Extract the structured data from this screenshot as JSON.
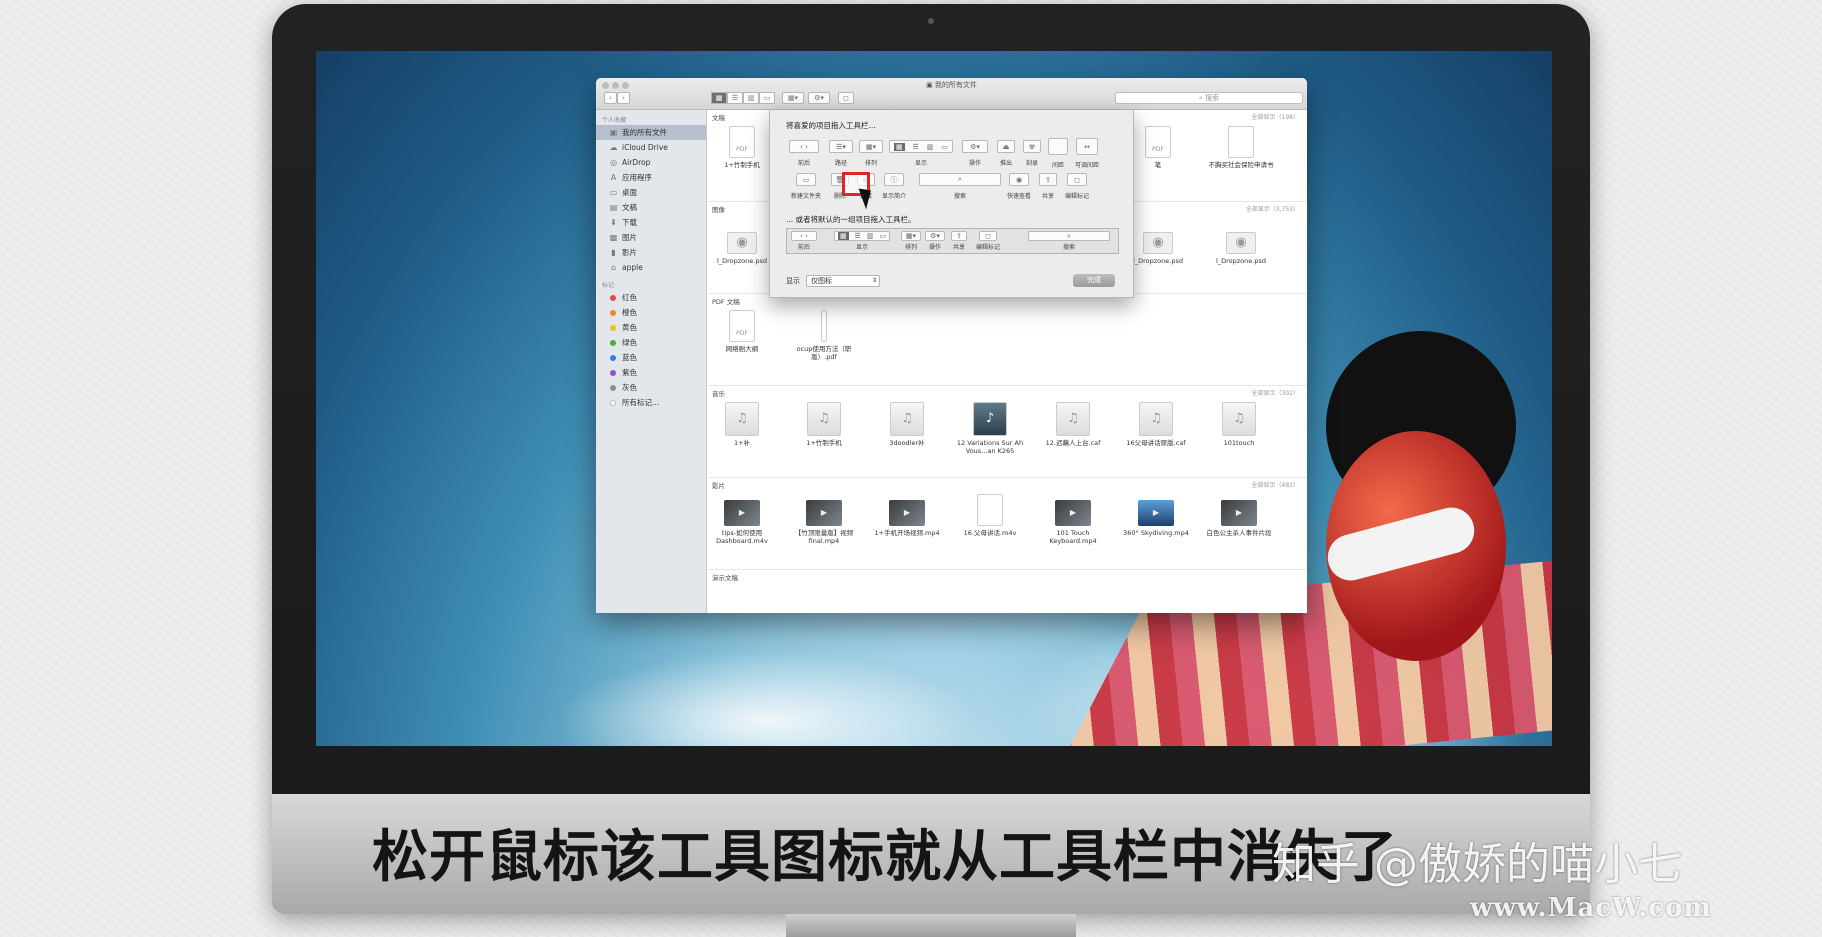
{
  "finder": {
    "title": "我的所有文件",
    "search_placeholder": "搜索",
    "nav_back": "‹",
    "nav_forward": "›"
  },
  "sidebar": {
    "favorites_heading": "个人收藏",
    "favorites": [
      {
        "label": "我的所有文件",
        "icon": "all-files-icon",
        "selected": true
      },
      {
        "label": "iCloud Drive",
        "icon": "cloud-icon"
      },
      {
        "label": "AirDrop",
        "icon": "airdrop-icon"
      },
      {
        "label": "应用程序",
        "icon": "applications-icon"
      },
      {
        "label": "桌面",
        "icon": "desktop-icon"
      },
      {
        "label": "文稿",
        "icon": "documents-icon"
      },
      {
        "label": "下载",
        "icon": "downloads-icon"
      },
      {
        "label": "图片",
        "icon": "pictures-icon"
      },
      {
        "label": "影片",
        "icon": "movies-icon"
      },
      {
        "label": "apple",
        "icon": "home-icon"
      }
    ],
    "tags_heading": "标记",
    "tags": [
      {
        "label": "红色",
        "color": "#e5484d"
      },
      {
        "label": "橙色",
        "color": "#f08a24"
      },
      {
        "label": "黄色",
        "color": "#e8c31f"
      },
      {
        "label": "绿色",
        "color": "#43b13a"
      },
      {
        "label": "蓝色",
        "color": "#2f7ee8"
      },
      {
        "label": "紫色",
        "color": "#9a4fd0"
      },
      {
        "label": "灰色",
        "color": "#8e8e8e"
      },
      {
        "label": "所有标记...",
        "color": "#c8c8c8"
      }
    ]
  },
  "sections": {
    "documents": {
      "title": "文稿",
      "count": "全部显示（198）",
      "items": [
        "1+竹制手机",
        "笔",
        "不胸买社会保险申请书"
      ]
    },
    "images": {
      "title": "图像",
      "count": "全部显示（3,753）",
      "items": [
        "l_Dropzone.psd",
        "l_Dropzone.psd",
        "l_Dropzone.psd"
      ]
    },
    "pdf": {
      "title": "PDF 文稿",
      "items": [
        "网络剧大纲",
        "ocup使用方法（职版）.pdf"
      ]
    },
    "music": {
      "title": "音乐",
      "count": "全部显示（302）",
      "items": [
        "1+补",
        "1+竹制手机",
        "3doodler补",
        "12 Variations Sur Ah Vous...an K265",
        "12.迟藕人上台.caf",
        "16父母讲话原版.caf",
        "101touch"
      ]
    },
    "movies": {
      "title": "影片",
      "count": "全部显示（483）",
      "items": [
        "tips-如何使用Dashboard.m4v",
        "【竹顶限量版】视频final.mp4",
        "1+手机开场视频.mp4",
        "16.父母讲话.m4v",
        "101 Touch Keyboard.mp4",
        "360° Skydiving.mp4",
        "白色公主杀人事件片段"
      ]
    },
    "presentations": {
      "title": "演示文稿"
    }
  },
  "customize": {
    "title": "将喜爱的项目拖入工具栏...",
    "row1": [
      {
        "label": "前后",
        "icon": "back-forward-icon"
      },
      {
        "label": "路径",
        "icon": "path-icon"
      },
      {
        "label": "排列",
        "icon": "arrange-icon"
      },
      {
        "label": "显示",
        "icon": "view-icon"
      },
      {
        "label": "操作",
        "icon": "gear-icon"
      },
      {
        "label": "推出",
        "icon": "eject-icon"
      },
      {
        "label": "刻录",
        "icon": "burn-icon"
      },
      {
        "label": "间距",
        "icon": "space-icon"
      },
      {
        "label": "可调间距",
        "icon": "flexible-space-icon"
      }
    ],
    "row2": [
      {
        "label": "新建文件夹",
        "icon": "new-folder-icon"
      },
      {
        "label": "删除",
        "icon": "trash-icon"
      },
      {
        "label": "连接",
        "icon": "connect-icon"
      },
      {
        "label": "显示简介",
        "icon": "info-icon"
      },
      {
        "label": "搜索",
        "icon": "search-icon"
      },
      {
        "label": "快速查看",
        "icon": "eye-icon"
      },
      {
        "label": "共享",
        "icon": "share-icon"
      },
      {
        "label": "编辑标记",
        "icon": "tag-icon"
      }
    ],
    "default_title": "... 或者将默认的一组项目拖入工具栏。",
    "default_set": [
      {
        "label": "前后"
      },
      {
        "label": "显示"
      },
      {
        "label": "排列"
      },
      {
        "label": "操作"
      },
      {
        "label": "共享"
      },
      {
        "label": "编辑标记"
      },
      {
        "label": "搜索"
      }
    ],
    "show_label": "显示",
    "show_value": "仅图标",
    "done_label": "完成"
  },
  "caption": "松开鼠标该工具图标就从工具栏中消失了",
  "watermark": "知乎 @傲娇的喵小七",
  "watermark_url": "www.MacW.com"
}
